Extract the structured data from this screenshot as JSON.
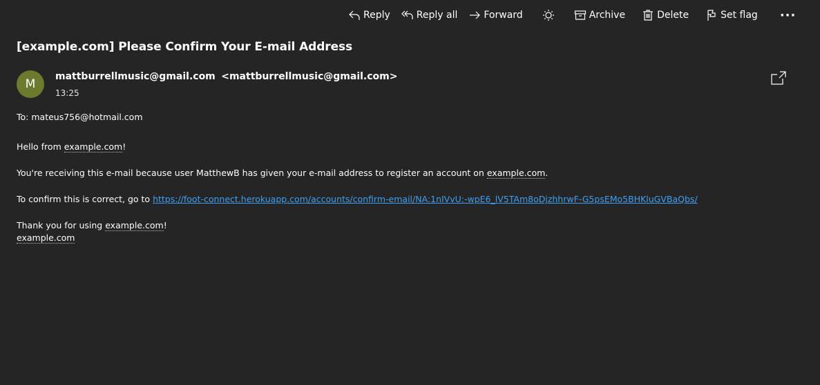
{
  "toolbar": {
    "reply": "Reply",
    "reply_all": "Reply all",
    "forward": "Forward",
    "archive": "Archive",
    "delete": "Delete",
    "set_flag": "Set flag",
    "more": "···"
  },
  "message": {
    "subject": "[example.com] Please Confirm Your E-mail Address",
    "avatar_letter": "M",
    "sender_name": "mattburrellmusic@gmail.com",
    "sender_address": "<mattburrellmusic@gmail.com>",
    "time": "13:25",
    "to_label": "To:",
    "to_address": "mateus756@hotmail.com"
  },
  "body": {
    "p1_pre": "Hello from ",
    "p1_link": "example.com",
    "p1_post": "!",
    "p2_pre": "You're receiving this e-mail because user MatthewB has given your e-mail address to register an account on ",
    "p2_link": "example.com",
    "p2_post": ".",
    "p3_pre": "To confirm this is correct, go to ",
    "p3_url": "https://foot-connect.herokuapp.com/accounts/confirm-email/NA:1nIVvU:-wpE6_lV5TAm8oDjzhhrwF-G5psEMo5BHKluGVBaQbs/",
    "p4_pre": "Thank you for using ",
    "p4_link": "example.com",
    "p4_post": "!",
    "signature": "example.com"
  },
  "colors": {
    "background": "#252525",
    "link": "#3ea0f5",
    "avatar": "#6b7a2c"
  }
}
